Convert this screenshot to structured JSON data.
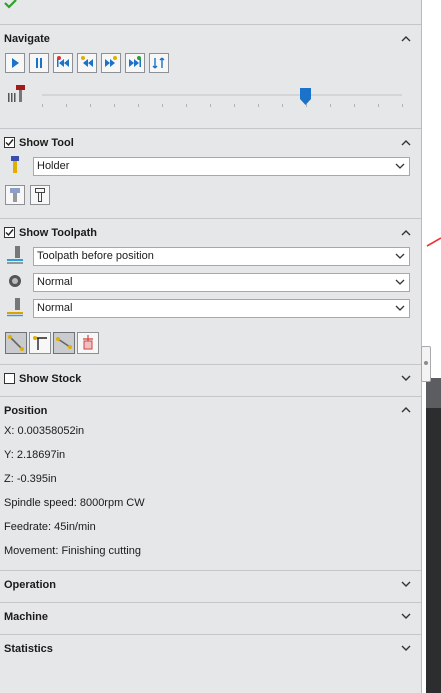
{
  "navigate": {
    "title": "Navigate",
    "buttons": [
      "play",
      "pause",
      "step-back-to-start",
      "step-back",
      "step-forward",
      "step-forward-to-end",
      "swap"
    ]
  },
  "show_tool": {
    "title": "Show Tool",
    "checked": true,
    "mode": "Holder"
  },
  "show_toolpath": {
    "title": "Show Toolpath",
    "checked": true,
    "mode": "Toolpath before position",
    "display1": "Normal",
    "display2": "Normal"
  },
  "show_stock": {
    "title": "Show Stock",
    "checked": false
  },
  "position": {
    "title": "Position",
    "x": "X: 0.00358052in",
    "y": "Y: 2.18697in",
    "z": "Z: -0.395in",
    "spindle": "Spindle speed: 8000rpm CW",
    "feedrate": "Feedrate: 45in/min",
    "movement": "Movement: Finishing cutting"
  },
  "sections": {
    "operation": "Operation",
    "machine": "Machine",
    "statistics": "Statistics"
  },
  "slider": {
    "fraction": 0.73
  },
  "colors": {
    "accent": "#1a73c9",
    "panel": "#e6e7e9",
    "cut": "#e33"
  }
}
